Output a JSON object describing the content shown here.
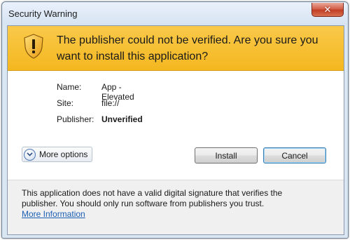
{
  "window": {
    "title": "Security Warning",
    "close_glyph": "✕"
  },
  "banner": {
    "message": "The publisher could not be verified. Are you sure you want to install this application?",
    "icon": "warning-shield-icon",
    "color": "#f4b71f"
  },
  "details": {
    "name_label": "Name:",
    "name_value": "App -  Elevated",
    "site_label": "Site:",
    "site_value": "file://",
    "publisher_label": "Publisher:",
    "publisher_value": "Unverified"
  },
  "actions": {
    "more_options_label": "More options",
    "install_label": "Install",
    "cancel_label": "Cancel"
  },
  "footer": {
    "text": "This application does not have a valid digital signature that verifies the publisher. You should only run software from publishers you trust.",
    "link_text": "More Information"
  }
}
